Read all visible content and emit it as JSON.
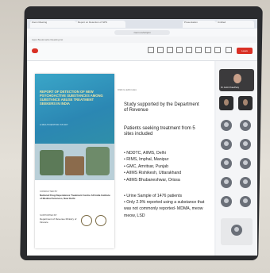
{
  "browser": {
    "tabs": [
      {
        "label": "Zoom Meeting"
      },
      {
        "label": "Report on Detection of NPS"
      },
      {
        "label": "Presentation"
      },
      {
        "label": "Untitled"
      }
    ],
    "url": "zoom.us/wc/join",
    "bookmarks": "Apps  Bookmarks  Reading list"
  },
  "meeting": {
    "leave_label": "Leave"
  },
  "slide": {
    "cover": {
      "title": "REPORT OF DETECTION OF NEW PSYCHOACTIVE SUBSTANCES AMONG SUBSTANCE ABUSE TREATMENT SEEKERS IN INDIA",
      "subtitle": "A MULTICENTRIC STUDY",
      "conducted_by_label": "CONDUCTED BY",
      "centre": "National Drug Dependence Treatment Centre All India Institute of Medical Sciences, New Delhi",
      "supported_by_label": "SUPPORTED BY",
      "department": "Department of Revenue Ministry of Finance"
    },
    "notes": {
      "label": "Click to add notes",
      "heading": "Study supported by the Department of Revenue",
      "section": "Patients seeking treatment from 5 sites included",
      "sites": [
        "NDDTC, AIIMS, Delhi",
        "RIMS, Imphal, Manipur",
        "GMC, Amritsar, Punjab",
        "AIIMS Rishikesh, Uttarakhand",
        "AIIMS Bhubaneshwar, Orissa"
      ],
      "findings": [
        "Urine Sample of 1476 patients",
        "Only 2.9% reported using a substance that was not commonly reported- MDMA, meow meow, LSD"
      ]
    }
  },
  "participants": {
    "main_name": "Dr. Ankit Chaudhary"
  }
}
